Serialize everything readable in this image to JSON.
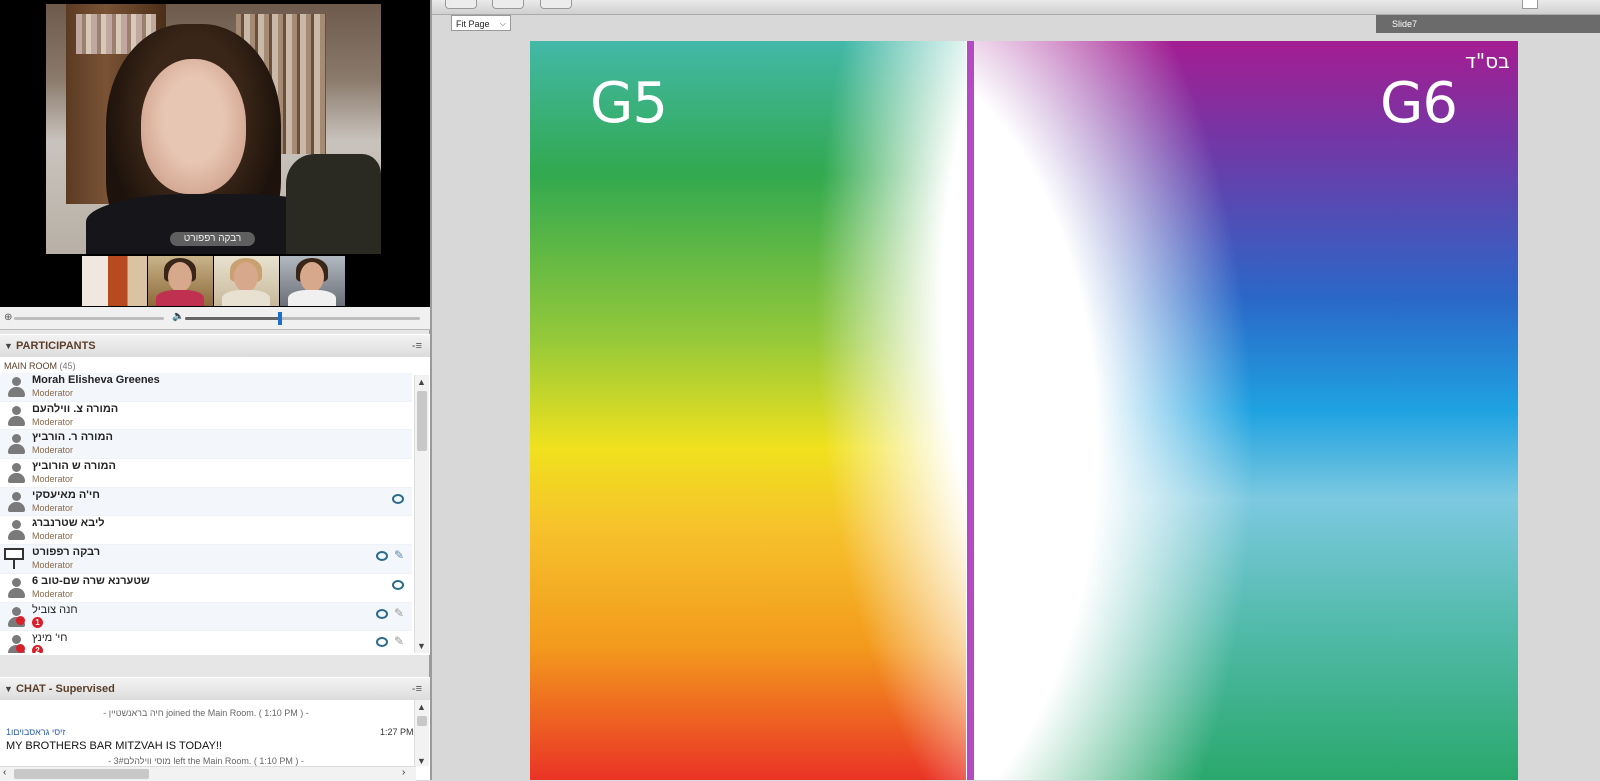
{
  "video": {
    "speaker_label": "רבקה רפפורט"
  },
  "participants": {
    "header": "PARTICIPANTS",
    "menu_icon": "-≡",
    "room_name": "MAIN ROOM",
    "room_count": "(45)",
    "list": [
      {
        "name": "Morah Elisheva Greenes",
        "role": "Moderator"
      },
      {
        "name": "המורה צ. ווילהעם",
        "role": "Moderator"
      },
      {
        "name": "המורה ר. הורביץ",
        "role": "Moderator"
      },
      {
        "name": "המורה ש הורוביץ",
        "role": "Moderator"
      },
      {
        "name": "חי'ה מאיעסקי",
        "role": "Moderator"
      },
      {
        "name": "ליבא שטרנברג",
        "role": "Moderator"
      },
      {
        "name": "רבקה רפפורט",
        "role": "Moderator"
      },
      {
        "name": "שטערנא שרה שם-טוב 6",
        "role": "Moderator"
      },
      {
        "name": "חנה צוביל",
        "badge": "1"
      },
      {
        "name": "חי' מינץ",
        "badge": "2"
      }
    ]
  },
  "chat": {
    "header": "CHAT - Supervised",
    "menu_icon": "-≡",
    "system_join": "- חיה בראנשטיין joined the Main Room. ( 1:10 PM ) -",
    "sender": "זיסי גראסבויםו1",
    "time": "1:27 PM",
    "message": "MY BROTHERS BAR MITZVAH IS TODAY!!",
    "system_left": "- מוסי ווילהלם3# left the Main Room. ( 1:10 PM ) -"
  },
  "toolbar": {
    "fit_select": "Fit Page",
    "slide_tab": "Slide7"
  },
  "slide": {
    "left_label": "G5",
    "right_label": "G6",
    "corner_text": "בס\"ד"
  },
  "colors": {
    "divider": "#b44bc2",
    "header_text": "#5a3e2a",
    "badge": "#d8202a",
    "volume_knob": "#1a6fd0"
  }
}
